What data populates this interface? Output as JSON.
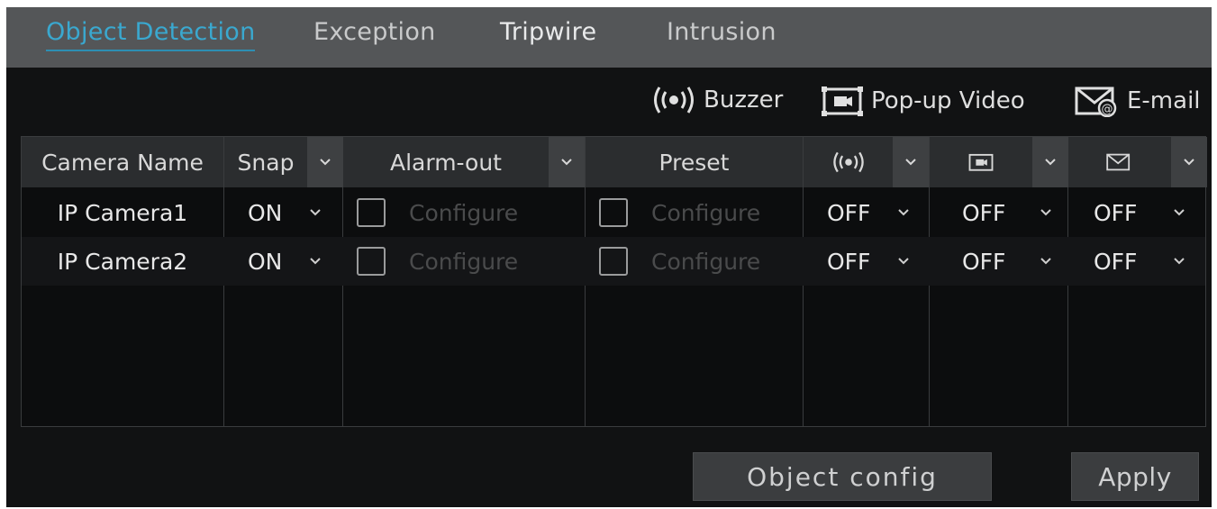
{
  "tabs": [
    {
      "label": "Object Detection",
      "active": true
    },
    {
      "label": "Exception",
      "active": false
    },
    {
      "label": "Tripwire",
      "active": false
    },
    {
      "label": "Intrusion",
      "active": false
    }
  ],
  "legend": {
    "buzzer": {
      "label": "Buzzer",
      "icon": "buzzer-icon"
    },
    "popup": {
      "label": "Pop-up Video",
      "icon": "popup-video-icon"
    },
    "email": {
      "label": "E-mail",
      "icon": "email-icon"
    }
  },
  "table": {
    "headers": {
      "camera_name": "Camera Name",
      "snap": "Snap",
      "alarm_out": "Alarm-out",
      "preset": "Preset"
    },
    "rows": [
      {
        "camera": "IP Camera1",
        "snap": "ON",
        "alarm_out": "Configure",
        "preset": "Configure",
        "buzzer": "OFF",
        "popup": "OFF",
        "email": "OFF"
      },
      {
        "camera": "IP Camera2",
        "snap": "ON",
        "alarm_out": "Configure",
        "preset": "Configure",
        "buzzer": "OFF",
        "popup": "OFF",
        "email": "OFF"
      }
    ]
  },
  "buttons": {
    "object_config": "Object config",
    "apply": "Apply"
  },
  "colors": {
    "accent": "#3aa8cf",
    "panel_bg": "#111213",
    "tabbar_bg": "#545658"
  }
}
